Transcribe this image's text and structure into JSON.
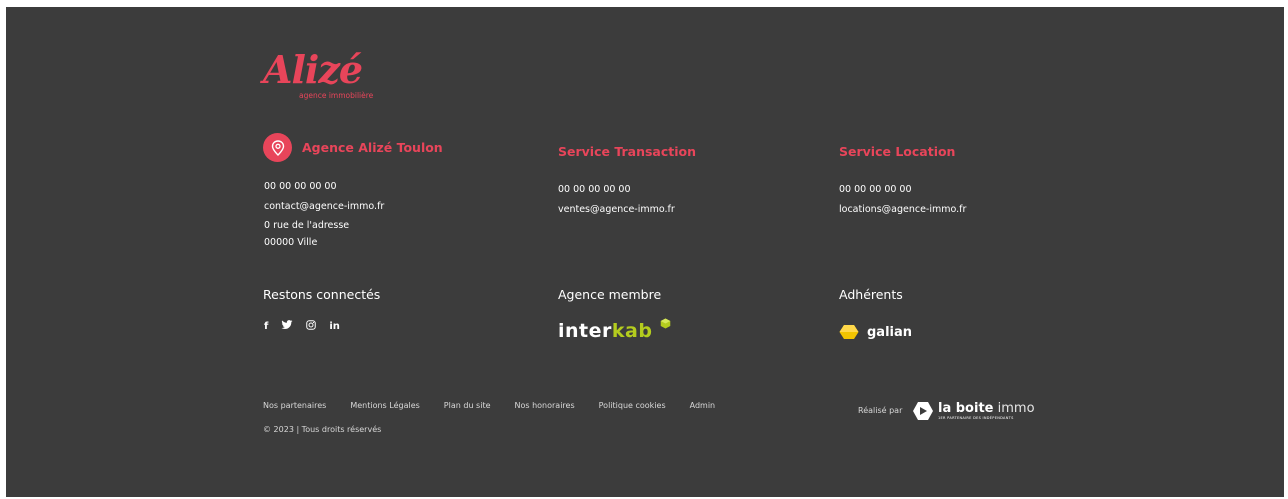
{
  "logo": {
    "wordmark": "Alizé",
    "tagline": "agence immobilière"
  },
  "agency": {
    "title": "Agence Alizé Toulon",
    "phone": "00 00 00 00 00",
    "email": "contact@agence-immo.fr",
    "address_line1": "0 rue de l'adresse",
    "address_line2": "00000 Ville"
  },
  "transaction": {
    "title": "Service Transaction",
    "phone": "00 00 00 00 00",
    "email": "ventes@agence-immo.fr"
  },
  "location": {
    "title": "Service Location",
    "phone": "00 00 00 00 00",
    "email": "locations@agence-immo.fr"
  },
  "social": {
    "title": "Restons connectés",
    "icons": [
      "facebook-icon",
      "twitter-icon",
      "instagram-icon",
      "linkedin-icon"
    ],
    "facebook_glyph": "f",
    "linkedin_glyph": "in"
  },
  "member": {
    "title": "Agence membre",
    "brand_part1": "inter",
    "brand_part2": "kab"
  },
  "adherents": {
    "title": "Adhérents",
    "brand": "galian"
  },
  "footer_links": [
    "Nos partenaires",
    "Mentions Légales",
    "Plan du site",
    "Nos honoraires",
    "Politique cookies",
    "Admin"
  ],
  "copyright": "© 2023 | Tous droits réservés",
  "credit": {
    "prefix": "Réalisé par",
    "brand_bold": "la boite",
    "brand_light": "immo",
    "brand_sub": "1ER PARTENAIRE DES INDÉPENDANTS"
  },
  "colors": {
    "background": "#3c3c3c",
    "accent": "#e8455a",
    "interkab_green": "#b4cc1e",
    "galian_yellow": "#f2c400"
  }
}
